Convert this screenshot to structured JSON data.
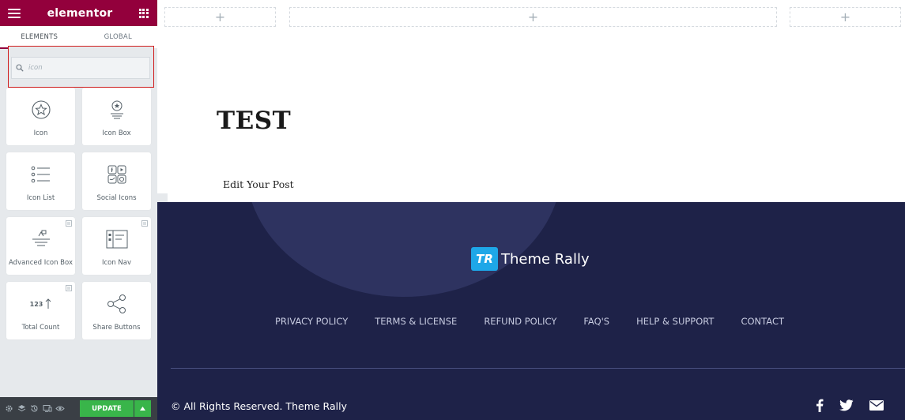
{
  "sidebar": {
    "brand": "elementor",
    "tabs": [
      "ELEMENTS",
      "GLOBAL"
    ],
    "search": {
      "placeholder": "icon",
      "value": ""
    },
    "widgets": [
      {
        "label": "Icon",
        "icon": "star-circle-icon",
        "pro": false
      },
      {
        "label": "Icon Box",
        "icon": "icon-box-icon",
        "pro": false
      },
      {
        "label": "Icon List",
        "icon": "icon-list-icon",
        "pro": false
      },
      {
        "label": "Social Icons",
        "icon": "social-icons-icon",
        "pro": false
      },
      {
        "label": "Advanced Icon Box",
        "icon": "advanced-icon-box-icon",
        "pro": true
      },
      {
        "label": "Icon Nav",
        "icon": "icon-nav-icon",
        "pro": true
      },
      {
        "label": "Total Count",
        "icon": "total-count-icon",
        "pro": true,
        "icon_text": "123"
      },
      {
        "label": "Share Buttons",
        "icon": "share-icon",
        "pro": false
      }
    ],
    "footer": {
      "update_label": "UPDATE"
    }
  },
  "page": {
    "title": "TEST",
    "edit_link": "Edit Your Post"
  },
  "site_footer": {
    "logo_mark": "TR",
    "logo_text": "Theme Rally",
    "nav": [
      "PRIVACY POLICY",
      "TERMS & LICENSE",
      "REFUND POLICY",
      "FAQ'S",
      "HELP & SUPPORT",
      "CONTACT"
    ],
    "copyright": "© All Rights Reserved. Theme Rally",
    "socials": [
      "facebook-icon",
      "twitter-icon",
      "email-icon"
    ]
  },
  "colors": {
    "brand": "#93003c",
    "update": "#39b54a",
    "footer_bg": "#1e2248",
    "highlight": "#d01c1c",
    "logo_blue": "#1ea7e8"
  }
}
